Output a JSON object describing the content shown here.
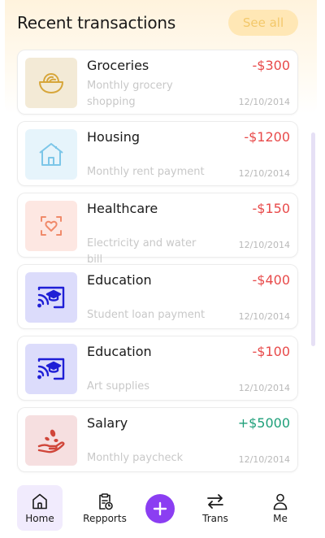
{
  "header": {
    "title": "Recent transactions",
    "see_all_label": "See all"
  },
  "transactions": [
    {
      "title": "Groceries",
      "amount": "-$300",
      "description": "Monthly grocery shopping",
      "date": "12/10/2014",
      "icon": "grocery-bowl-icon"
    },
    {
      "title": "Housing",
      "amount": "-$1200",
      "description": "Monthly rent payment",
      "date": "12/10/2014",
      "icon": "house-icon"
    },
    {
      "title": "Healthcare",
      "amount": "-$150",
      "description": "Electricity and water bill",
      "date": "12/10/2014",
      "icon": "heart-scan-icon"
    },
    {
      "title": "Education",
      "amount": "-$400",
      "description": "Student loan payment",
      "date": "12/10/2014",
      "icon": "graduation-cap-icon"
    },
    {
      "title": "Education",
      "amount": "-$100",
      "description": "Art supplies",
      "date": "12/10/2014",
      "icon": "graduation-cap-icon"
    },
    {
      "title": "Salary",
      "amount": "+$5000",
      "description": "Monthly paycheck",
      "date": "12/10/2014",
      "icon": "money-hand-icon"
    }
  ],
  "nav": {
    "home": "Home",
    "reports": "Repports",
    "trans": "Trans",
    "me": "Me"
  },
  "colors": {
    "negative": "#e84a4a",
    "positive": "#1fa07a",
    "accent": "#8b3ef2",
    "see_all_bg": "#ffe7b5"
  }
}
